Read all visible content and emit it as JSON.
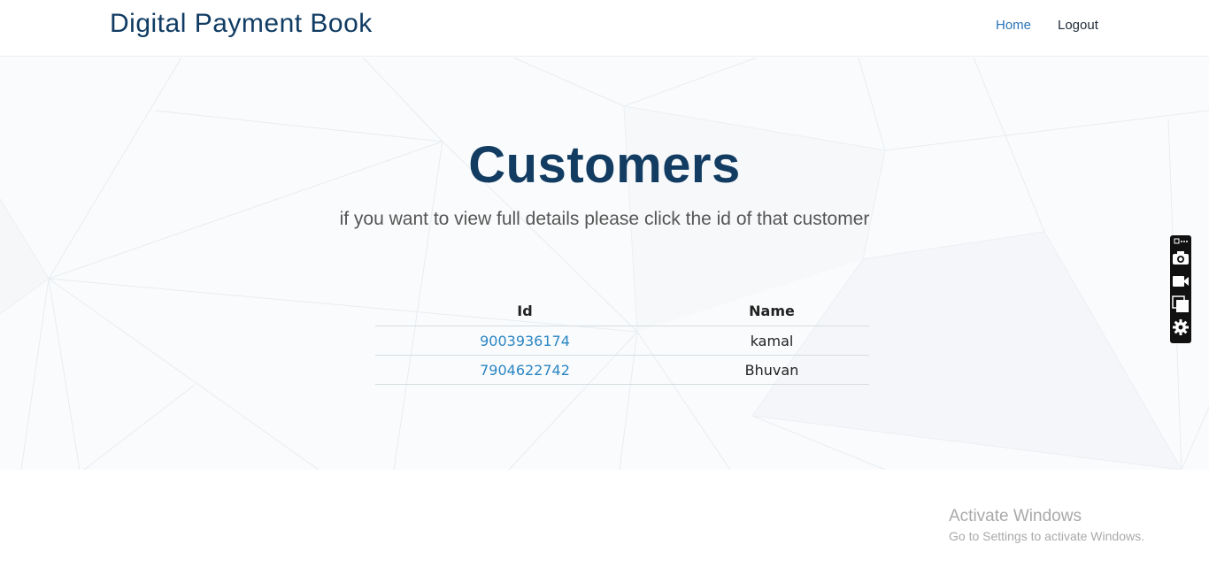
{
  "navbar": {
    "brand": "Digital Payment Book",
    "home_label": "Home",
    "logout_label": "Logout"
  },
  "main": {
    "title": "Customers",
    "subtitle": "if you want to view full details please click the id of that customer"
  },
  "table": {
    "headers": {
      "id": "Id",
      "name": "Name"
    },
    "rows": [
      {
        "id": "9003936174",
        "name": "kamal"
      },
      {
        "id": "7904622742",
        "name": "Bhuvan"
      }
    ]
  },
  "toolbar": {
    "icons": [
      "more-icon",
      "camera-icon",
      "video-icon",
      "copy-icon",
      "gear-icon"
    ]
  },
  "watermark": {
    "title": "Activate Windows",
    "subtitle": "Go to Settings to activate Windows."
  },
  "colors": {
    "brand": "#103c63",
    "title": "#123c61",
    "link": "#2a86c4",
    "nav_active": "#2a73b6"
  }
}
